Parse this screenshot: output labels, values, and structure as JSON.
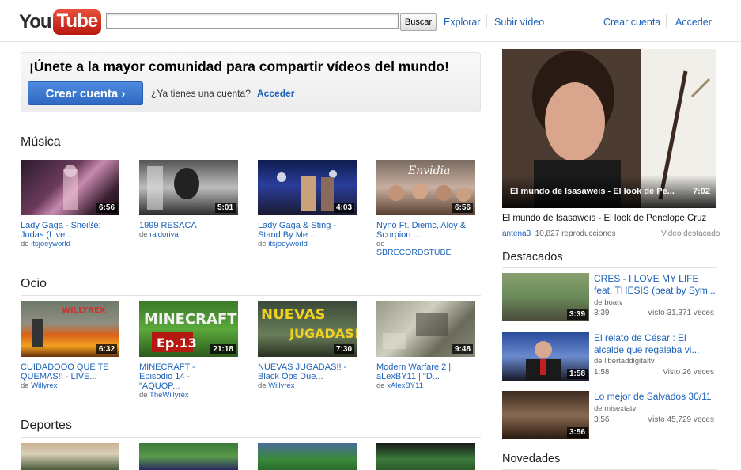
{
  "header": {
    "logo_you": "You",
    "logo_tube": "Tube",
    "search_placeholder": "",
    "search_button": "Buscar",
    "nav": [
      "Explorar",
      "Subir vídeo"
    ],
    "account": [
      "Crear cuenta",
      "Acceder"
    ]
  },
  "promo": {
    "title": "¡Únete a la mayor comunidad para compartir vídeos del mundo!",
    "button": "Crear cuenta ›",
    "question": "¿Ya tienes una cuenta?",
    "login": "Acceder"
  },
  "sections": [
    {
      "title": "Música",
      "videos": [
        {
          "title": "Lady Gaga - Sheiße; Judas (Live ...",
          "by_prefix": "de",
          "channel": "itsjoeyworld",
          "duration": "6:56"
        },
        {
          "title": "1999 RESACA",
          "by_prefix": "de",
          "channel": "raidoriva",
          "duration": "5:01"
        },
        {
          "title": "Lady Gaga & Sting - Stand By Me ...",
          "by_prefix": "de",
          "channel": "itsjoeyworld",
          "duration": "4:03"
        },
        {
          "title": "Nyno Ft. Diemc, Aloy & Scorpion ...",
          "by_prefix": "de",
          "channel": "SBRECORDSTUBE",
          "duration": "6:56",
          "thumb_text": "Envidia"
        }
      ]
    },
    {
      "title": "Ocio",
      "videos": [
        {
          "title": "CUIDADOOO QUE TE QUEMAS!! - LIVE...",
          "by_prefix": "de",
          "channel": "Willyrex",
          "duration": "6:32",
          "thumb_text": "WILLYREX"
        },
        {
          "title": "MINECRAFT - Episodio 14 - \"AQUOP...",
          "by_prefix": "de",
          "channel": "TheWillyrex",
          "duration": "21:18",
          "thumb_text": "MINECRAFT",
          "thumb_text2": "Ep.13"
        },
        {
          "title": "NUEVAS JUGADAS!! - Black Ops Due...",
          "by_prefix": "de",
          "channel": "Willyrex",
          "duration": "7:30",
          "thumb_text": "NUEVAS",
          "thumb_text2": "JUGADAS!"
        },
        {
          "title": "Modern Warfare 2 | aLexBY11 | \"D...",
          "by_prefix": "de",
          "channel": "xAlexBY11",
          "duration": "9:48"
        }
      ]
    },
    {
      "title": "Deportes",
      "videos": [
        {},
        {},
        {},
        {}
      ]
    }
  ],
  "featured": {
    "caption": "El mundo de Isasaweis - El look de Pe...",
    "duration": "7:02",
    "title": "El mundo de Isasaweis - El look de Penelope Cruz",
    "channel": "antena3",
    "views": "10,827 reproducciones",
    "tag": "Video destacado"
  },
  "destacados": {
    "title": "Destacados",
    "items": [
      {
        "title": "CRES - I LOVE MY LIFE feat. THESIS (beat by Sym...",
        "by": "de boatv",
        "duration": "3:39",
        "views": "Visto 31,371 veces"
      },
      {
        "title": "El relato de César : El alcalde que regalaba vi...",
        "by": "de libertaddigitaltv",
        "duration": "1:58",
        "views": "Visto 26 veces"
      },
      {
        "title": "Lo mejor de Salvados 30/11",
        "by": "de misextatv",
        "duration": "3:56",
        "views": "Visto 45,729 veces"
      }
    ]
  },
  "novedades": {
    "title": "Novedades"
  }
}
